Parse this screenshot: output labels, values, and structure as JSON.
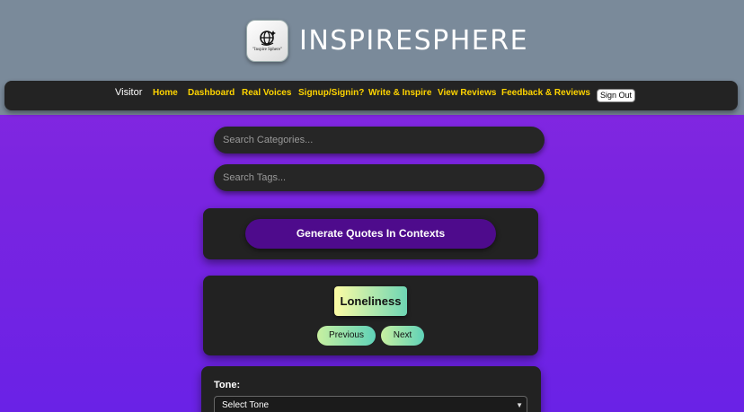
{
  "header": {
    "brand_name": "INSPIRESPHERE",
    "logo_text": "\"Inspire Sphere\""
  },
  "nav": {
    "visitor": "Visitor",
    "items": [
      "Home",
      "Dashboard",
      "Real Voices",
      "Signup/Signin?",
      "Write & Inspire",
      "View Reviews",
      "Feedback & Reviews"
    ],
    "signout": "Sign Out"
  },
  "search": {
    "categories_placeholder": "Search Categories...",
    "tags_placeholder": "Search Tags..."
  },
  "generate": {
    "label": "Generate Quotes In Contexts"
  },
  "context": {
    "topic": "Loneliness",
    "previous": "Previous",
    "next": "Next"
  },
  "tone": {
    "label": "Tone:",
    "selected": "Select Tone"
  },
  "colors": {
    "accent_yellow": "#ffd400",
    "header_bg": "#7a8a9a",
    "panel_bg": "#222222",
    "button_purple": "#4e0b8c",
    "page_purple": "#8a2be2"
  }
}
